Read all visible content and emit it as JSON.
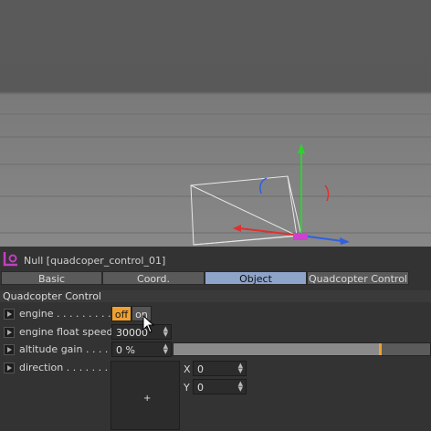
{
  "object": {
    "title": "Null [quadcoper_control_01]"
  },
  "tabs": [
    {
      "label": "Basic",
      "active": false
    },
    {
      "label": "Coord.",
      "active": false
    },
    {
      "label": "Object",
      "active": true
    },
    {
      "label": "Quadcopter Control",
      "active": false
    }
  ],
  "section": {
    "title": "Quadcopter Control"
  },
  "params": {
    "engine": {
      "label": "engine . . . . . . . . . .",
      "off_label": "off",
      "on_label": "on",
      "state": "off"
    },
    "float_speed": {
      "label": "engine float speed",
      "value": "30000"
    },
    "altitude": {
      "label": "altitude gain . . . . .",
      "value": "0 %",
      "slider_fill": 0.8
    },
    "direction": {
      "label": "direction . . . . . . . .",
      "x_label": "X",
      "x_value": "0",
      "y_label": "Y",
      "y_value": "0"
    }
  },
  "colors": {
    "accent": "#f0a030",
    "active_tab": "#8ea3c8",
    "x_axis": "#e03030",
    "y_axis": "#30d030",
    "z_axis": "#3060e0"
  }
}
